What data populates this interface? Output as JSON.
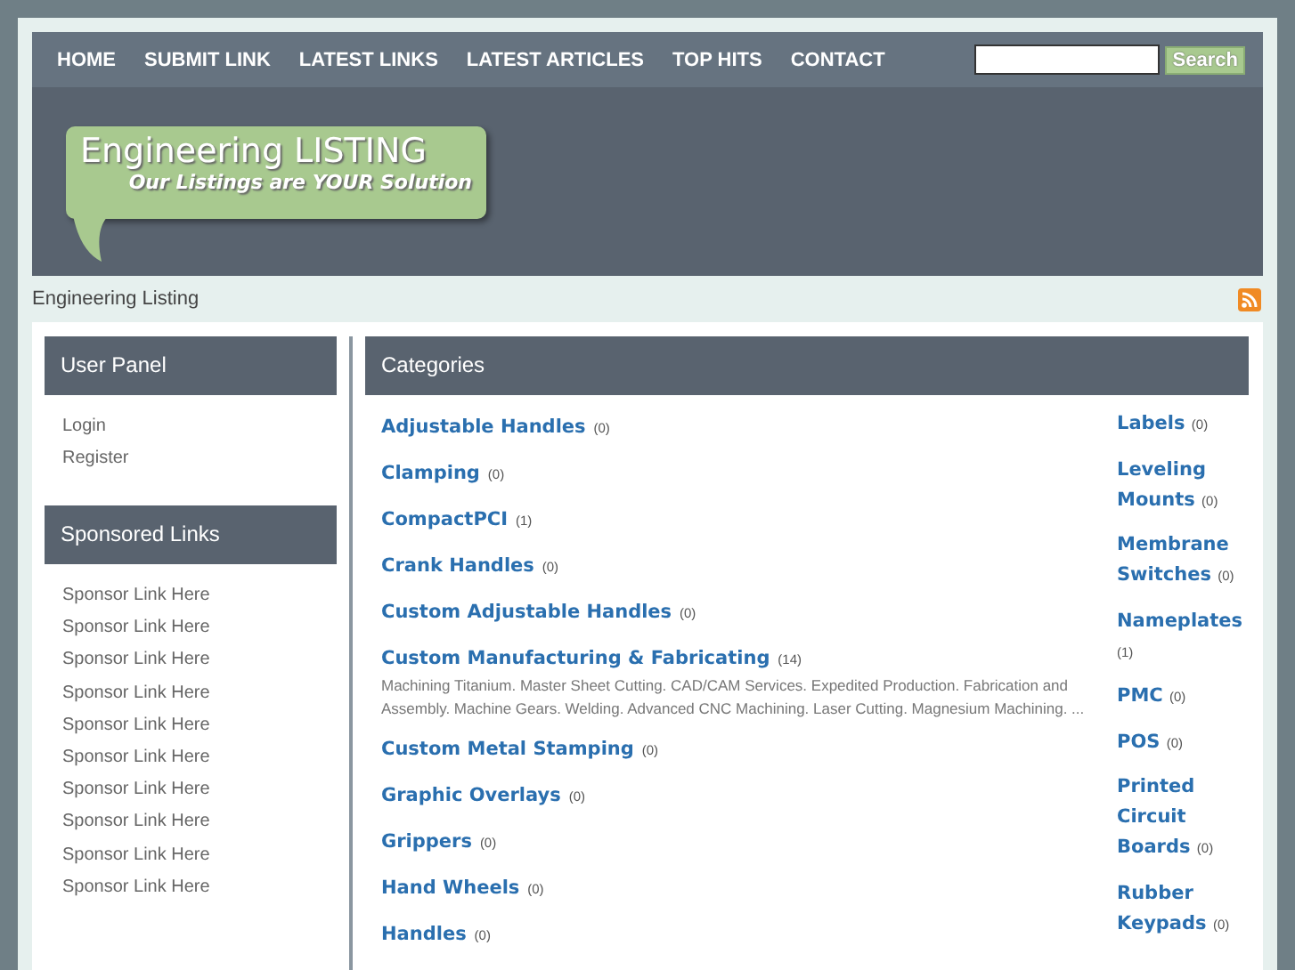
{
  "nav": {
    "items": [
      "HOME",
      "SUBMIT LINK",
      "LATEST LINKS",
      "LATEST ARTICLES",
      "TOP HITS",
      "CONTACT"
    ],
    "search": {
      "button": "Search"
    }
  },
  "logo": {
    "title": "Engineering LISTING",
    "tagline": "Our Listings are YOUR Solution"
  },
  "breadcrumb": "Engineering Listing",
  "user_panel": {
    "title": "User Panel",
    "links": [
      "Login",
      "Register"
    ]
  },
  "sponsored": {
    "title": "Sponsored Links",
    "links": [
      "Sponsor Link Here",
      "Sponsor Link Here",
      "Sponsor Link Here",
      "Sponsor Link Here",
      "Sponsor Link Here",
      "Sponsor Link Here",
      "Sponsor Link Here",
      "Sponsor Link Here",
      "Sponsor Link Here",
      "Sponsor Link Here"
    ]
  },
  "categories": {
    "title": "Categories",
    "column_1": [
      {
        "name": "Adjustable Handles",
        "count": "(0)"
      },
      {
        "name": "Clamping",
        "count": "(0)"
      },
      {
        "name": "CompactPCI",
        "count": "(1)"
      },
      {
        "name": "Crank Handles",
        "count": "(0)"
      },
      {
        "name": "Custom Adjustable Handles",
        "count": "(0)"
      },
      {
        "name": "Custom Manufacturing & Fabricating",
        "count": "(14)",
        "description": "Machining Titanium. Master Sheet Cutting. CAD/CAM Services. Expedited Production. Fabrication and Assembly. Machine Gears. Welding. Advanced CNC Machining. Laser Cutting. Magnesium Machining. ..."
      },
      {
        "name": "Custom Metal Stamping",
        "count": "(0)"
      },
      {
        "name": "Graphic Overlays",
        "count": "(0)"
      },
      {
        "name": "Grippers",
        "count": "(0)"
      },
      {
        "name": "Hand Wheels",
        "count": "(0)"
      },
      {
        "name": "Handles",
        "count": "(0)"
      }
    ],
    "column_2": [
      {
        "name": "Labels",
        "count": "(0)"
      },
      {
        "name": "Leveling Mounts",
        "count": "(0)"
      },
      {
        "name": "Membrane Switches",
        "count": "(0)"
      },
      {
        "name": "Nameplates",
        "count": "(1)"
      },
      {
        "name": "PMC",
        "count": "(0)"
      },
      {
        "name": "POS",
        "count": "(0)"
      },
      {
        "name": "Printed Circuit Boards",
        "count": "(0)"
      },
      {
        "name": "Rubber Keypads",
        "count": "(0)"
      }
    ]
  }
}
